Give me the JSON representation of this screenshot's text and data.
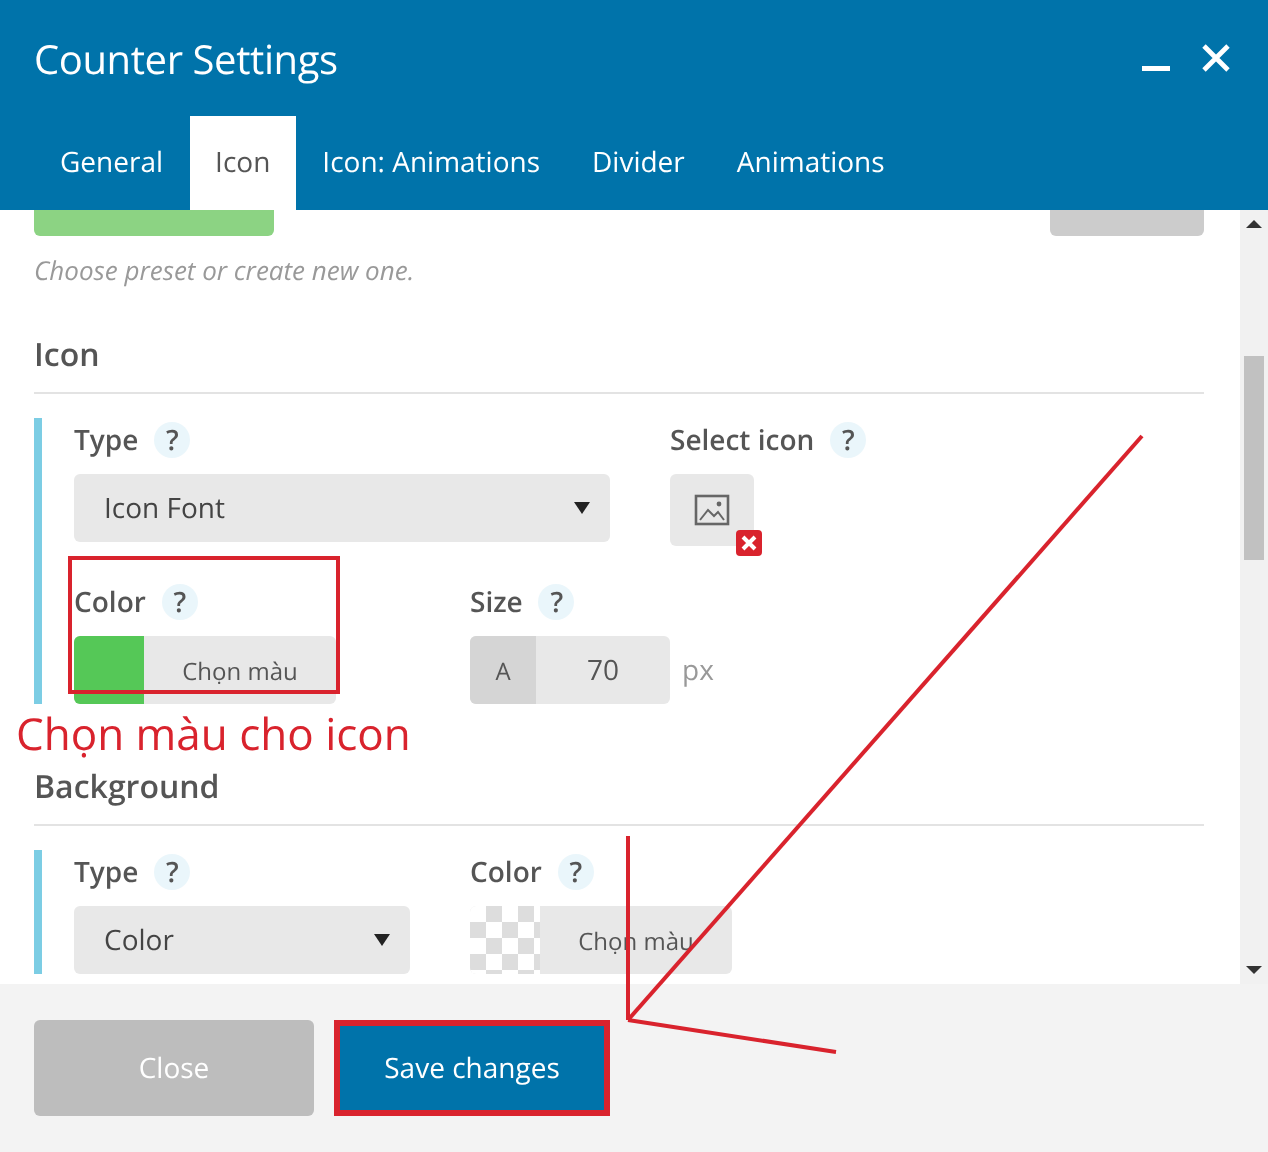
{
  "window": {
    "title": "Counter Settings"
  },
  "tabs": [
    {
      "label": "General",
      "selected": false
    },
    {
      "label": "Icon",
      "selected": true
    },
    {
      "label": "Icon: Animations",
      "selected": false
    },
    {
      "label": "Divider",
      "selected": false
    },
    {
      "label": "Animations",
      "selected": false
    }
  ],
  "preset": {
    "hint": "Choose preset or create new one."
  },
  "sections": [
    {
      "heading": "Icon",
      "rows": [
        {
          "fields": [
            {
              "kind": "select",
              "label": "Type",
              "help": "?",
              "value": "Icon Font",
              "highlighted": false
            },
            {
              "kind": "icon_picker",
              "label": "Select icon",
              "help": "?",
              "highlighted": false
            }
          ]
        },
        {
          "fields": [
            {
              "kind": "color",
              "label": "Color",
              "help": "?",
              "button": "Chọn màu",
              "color": "#55c857",
              "highlighted": true
            },
            {
              "kind": "number",
              "label": "Size",
              "help": "?",
              "prefix": "A",
              "value": "70",
              "unit": "px",
              "highlighted": false
            }
          ]
        }
      ]
    },
    {
      "heading": "Background",
      "rows": [
        {
          "fields": [
            {
              "kind": "select",
              "label": "Type",
              "help": "?",
              "value": "Color",
              "highlighted": false
            },
            {
              "kind": "color",
              "label": "Color",
              "help": "?",
              "button": "Chọn màu",
              "highlighted": false
            }
          ]
        }
      ]
    }
  ],
  "annotation": {
    "note": "Chọn màu cho icon"
  },
  "buttons": [
    {
      "label": "Close",
      "kind": "secondary",
      "highlighted": false
    },
    {
      "label": "Save changes",
      "kind": "primary",
      "highlighted": true
    }
  ]
}
